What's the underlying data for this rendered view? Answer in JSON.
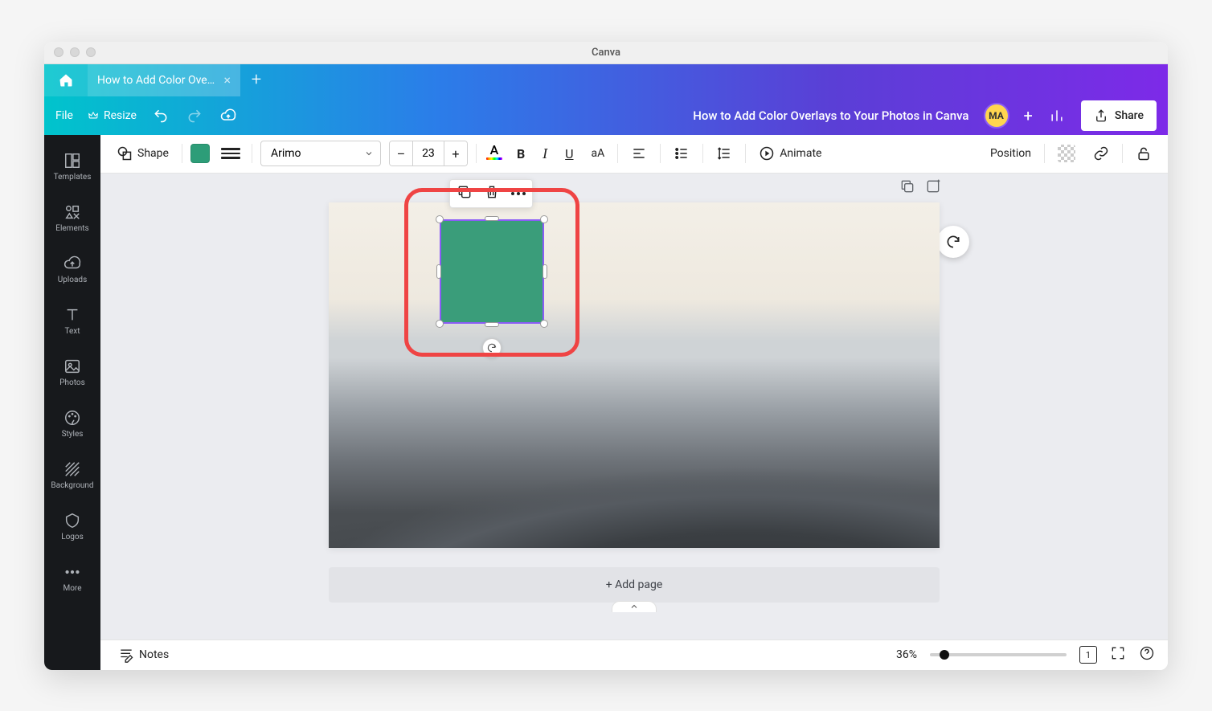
{
  "app_title": "Canva",
  "tab": {
    "label": "How to Add Color Ove..."
  },
  "menubar": {
    "file": "File",
    "resize": "Resize",
    "doc_title": "How to Add Color Overlays to Your Photos in Canva",
    "avatar_initials": "MA",
    "share": "Share"
  },
  "sidebar": {
    "templates": "Templates",
    "elements": "Elements",
    "uploads": "Uploads",
    "text": "Text",
    "photos": "Photos",
    "styles": "Styles",
    "background": "Background",
    "logos": "Logos",
    "more": "More"
  },
  "toolbar": {
    "shape": "Shape",
    "fill_color": "#2d9d78",
    "font": "Arimo",
    "font_size": "23",
    "animate": "Animate",
    "position": "Position"
  },
  "canvas": {
    "add_page": "+ Add page"
  },
  "footer": {
    "notes": "Notes",
    "zoom": "36%",
    "page_indicator": "1"
  }
}
